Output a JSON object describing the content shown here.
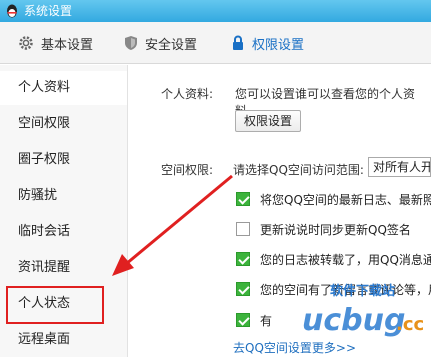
{
  "window": {
    "title": "系统设置"
  },
  "tabs": [
    {
      "label": "基本设置",
      "icon": "gear-icon"
    },
    {
      "label": "安全设置",
      "icon": "shield-icon"
    },
    {
      "label": "权限设置",
      "icon": "lock-icon",
      "active": true
    }
  ],
  "sidebar": {
    "items": [
      {
        "label": "个人资料",
        "active": true
      },
      {
        "label": "空间权限"
      },
      {
        "label": "圈子权限"
      },
      {
        "label": "防骚扰"
      },
      {
        "label": "临时会话"
      },
      {
        "label": "资讯提醒"
      },
      {
        "label": "个人状态",
        "highlighted": true
      },
      {
        "label": "远程桌面"
      }
    ]
  },
  "main": {
    "profile": {
      "label": "个人资料:",
      "description": "您可以设置谁可以查看您的个人资料。",
      "button": "权限设置"
    },
    "space": {
      "label": "空间权限:",
      "prompt": "请选择QQ空间访问范围:",
      "select_value": "对所有人开"
    },
    "checkboxes": [
      {
        "text": "将您QQ空间的最新日志、最新照片",
        "checked": true
      },
      {
        "text": "更新说说时同步更新QQ签名",
        "checked": false
      },
      {
        "text": "您的日志被转载了，用QQ消息通知",
        "checked": true
      },
      {
        "text": "您的空间有了新留言或评论等，用",
        "checked": true
      },
      {
        "text": "有",
        "checked": true
      }
    ],
    "link": "去QQ空间设置更多>>"
  },
  "watermark": {
    "brand": "ucbug.cc",
    "subtitle": "软件下载站"
  },
  "colors": {
    "titlebar": "#33a9e0",
    "active_tab": "#1a70c5",
    "highlight": "#e02020",
    "checkbox": "#3cb33c",
    "link": "#1f6fbf"
  }
}
